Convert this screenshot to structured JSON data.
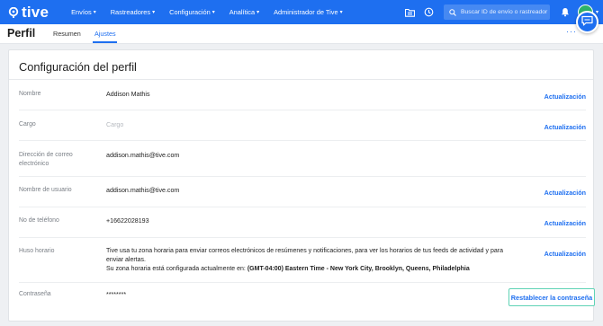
{
  "app": {
    "logo_text": "tive"
  },
  "nav": {
    "items": [
      {
        "label": "Envíos"
      },
      {
        "label": "Rastreadores"
      },
      {
        "label": "Configuración"
      },
      {
        "label": "Analítica"
      },
      {
        "label": "Administrador de Tive"
      }
    ],
    "search_placeholder": "Buscar ID de envío o rastreador"
  },
  "page": {
    "title": "Perfil",
    "tabs": [
      {
        "label": "Resumen"
      },
      {
        "label": "Ajustes"
      }
    ],
    "active_tab": "Ajustes"
  },
  "profile": {
    "heading": "Configuración del perfil",
    "rows": [
      {
        "label": "Nombre",
        "value": "Addison Mathis",
        "action": "Actualización"
      },
      {
        "label": "Cargo",
        "value": "Cargo",
        "action": "Actualización"
      },
      {
        "label": "Dirección de correo electrónico",
        "value": "addison.mathis@tive.com"
      },
      {
        "label": "Nombre de usuario",
        "value": "addison.mathis@tive.com",
        "action": "Actualización"
      },
      {
        "label": "No de teléfono",
        "value": "+16622028193",
        "action": "Actualización"
      },
      {
        "label": "Huso horario",
        "action": "Actualización"
      },
      {
        "label": "Contraseña",
        "value": "********",
        "action": "Restablecer la contraseña"
      }
    ],
    "timezone": {
      "description": "Tive usa tu zona horaria para enviar correos electrónicos de resúmenes y notificaciones, para ver los horarios de tus feeds de actividad y para enviar alertas.",
      "current_prefix": "Su zona horaria está configurada actualmente en:",
      "current_value": "(GMT-04:00) Eastern Time - New York City, Brooklyn, Queens, Philadelphia"
    }
  },
  "colors": {
    "brand": "#1e6ff0",
    "avatar": "#2db36a",
    "focus_outline": "#5fd3b5"
  }
}
